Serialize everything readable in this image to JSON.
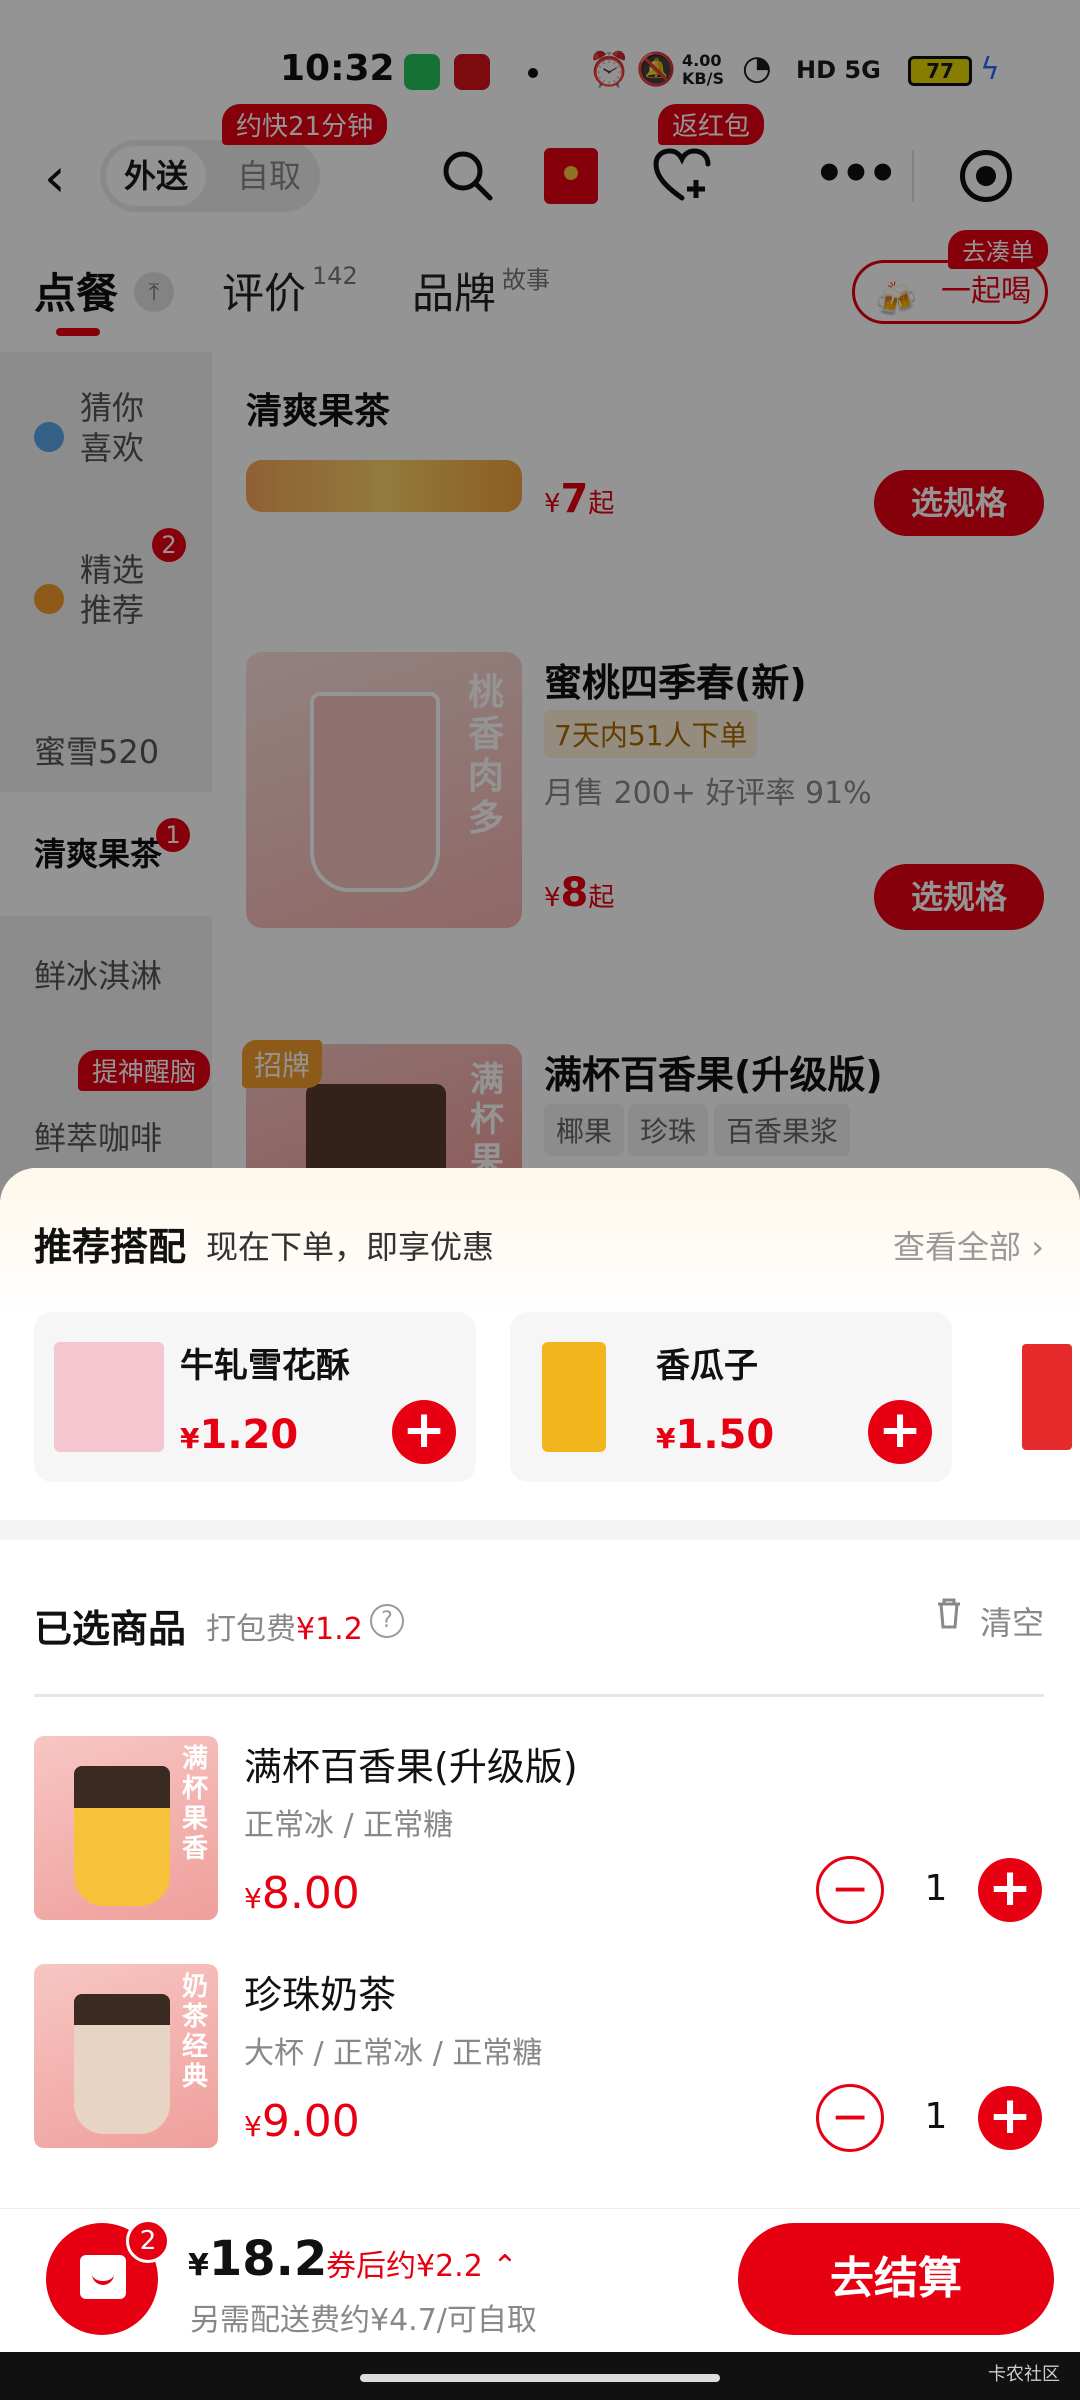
{
  "status_bar": {
    "time": "10:32",
    "net_speed": "4.00 KB/S",
    "right_icons": "HD 5G",
    "battery": "77"
  },
  "nav": {
    "mode_active": "外送",
    "mode_inactive": "自取",
    "badge_eta": "约快21分钟",
    "badge_redpacket": "返红包"
  },
  "tabs": {
    "order": "点餐",
    "reviews": "评价",
    "reviews_count": "142",
    "brand": "品牌",
    "brand_sup": "故事",
    "together": "一起喝",
    "together_badge": "去凑单"
  },
  "sidebar": {
    "items": [
      {
        "label": "猜你\n喜欢"
      },
      {
        "label": "精选\n推荐",
        "badge": "2"
      },
      {
        "label": "蜜雪520"
      },
      {
        "label": "清爽果茶",
        "badge": "1"
      },
      {
        "label": "鲜冰淇淋"
      },
      {
        "label": "鲜萃咖啡",
        "tag": "提神醒脑"
      }
    ]
  },
  "menu": {
    "section_title": "清爽果茶",
    "products": [
      {
        "price": "7",
        "price_suffix": "起",
        "button": "选规格"
      },
      {
        "name": "蜜桃四季春(新)",
        "tag": "7天内51人下单",
        "meta": "月售 200+ 好评率 91%",
        "price": "8",
        "price_suffix": "起",
        "button": "选规格",
        "img_text": "桃香肉多"
      },
      {
        "name": "满杯百香果(升级版)",
        "badge": "招牌",
        "chips": [
          "椰果",
          "珍珠",
          "百香果浆"
        ],
        "img_text": "满杯果"
      }
    ],
    "currency": "¥"
  },
  "recommend": {
    "title": "推荐搭配",
    "subtitle": "现在下单，即享优惠",
    "view_all": "查看全部 ›",
    "items": [
      {
        "name": "牛轧雪花酥",
        "price": "1.20",
        "thumb_color": "#f4c6cf"
      },
      {
        "name": "香瓜子",
        "price": "1.50",
        "thumb_color": "#f2b51c"
      }
    ]
  },
  "selected": {
    "title": "已选商品",
    "fee_label": "打包费",
    "fee_value": "¥1.2",
    "clear": "清空",
    "items": [
      {
        "name": "满杯百香果(升级版)",
        "options": "正常冰 / 正常糖",
        "price": "8.00",
        "qty": "1",
        "img_text": "满杯果香"
      },
      {
        "name": "珍珠奶茶",
        "options": "大杯 / 正常冰 / 正常糖",
        "price": "9.00",
        "qty": "1",
        "img_text": "奶茶经典"
      }
    ]
  },
  "checkout": {
    "cart_count": "2",
    "total": "18.2",
    "coupon_estimate": "券后约¥2.2 ⌃",
    "delivery_note": "另需配送费约¥4.7/可自取",
    "button": "去结算",
    "currency": "¥"
  },
  "watermark": "卡农社区",
  "colors": {
    "brand_red": "#e60012",
    "text_gray": "#888888"
  }
}
